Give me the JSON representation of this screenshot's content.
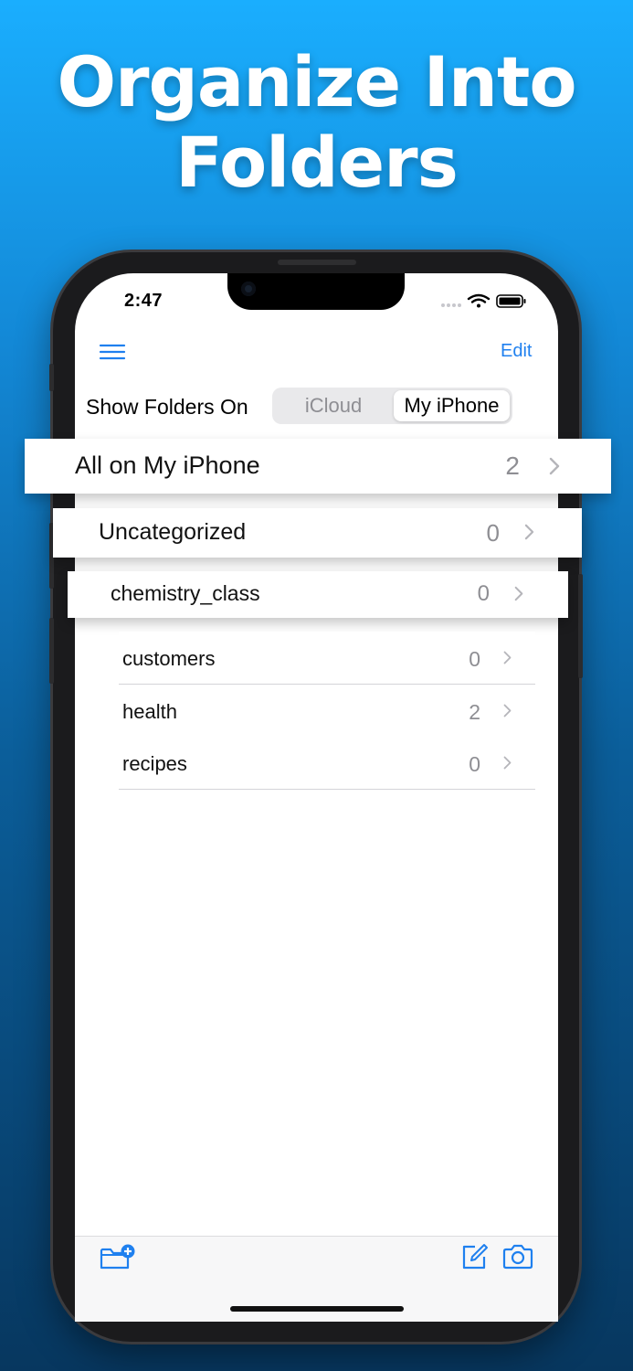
{
  "headline": {
    "line1": "Organize Into",
    "line2": "Folders"
  },
  "status_bar": {
    "time": "2:47"
  },
  "nav": {
    "edit_label": "Edit"
  },
  "source_picker": {
    "label": "Show Folders On",
    "options": [
      "iCloud",
      "My iPhone"
    ],
    "selected": "My iPhone"
  },
  "folders": {
    "all": {
      "name": "All on My iPhone",
      "count": "2"
    },
    "uncategorized": {
      "name": "Uncategorized",
      "count": "0"
    },
    "items": [
      {
        "name": "chemistry_class",
        "count": "0"
      },
      {
        "name": "customers",
        "count": "0"
      },
      {
        "name": "health",
        "count": "2"
      },
      {
        "name": "recipes",
        "count": "0"
      }
    ]
  },
  "colors": {
    "accent": "#1f80ef",
    "background_top": "#1aaefe",
    "background_bottom": "#07375f"
  }
}
